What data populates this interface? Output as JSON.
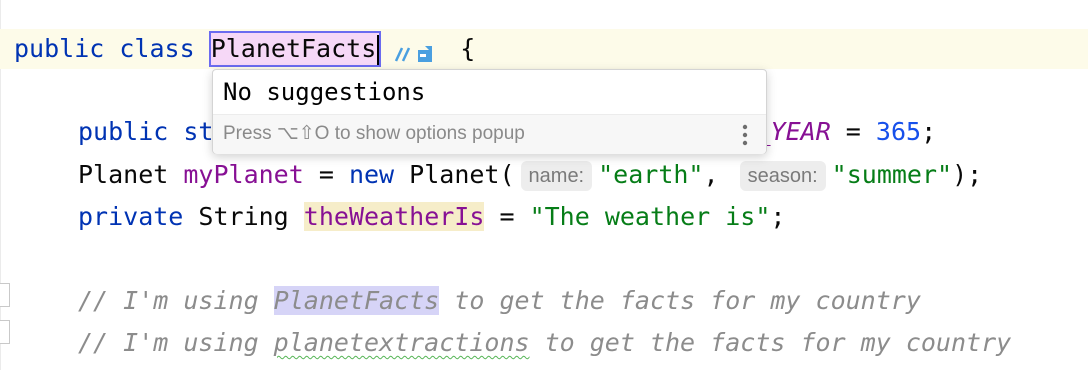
{
  "editor": {
    "line1": {
      "kw_public": "public",
      "kw_class": "class",
      "class_name": "PlanetFacts",
      "brace": "{"
    },
    "line2": {
      "kw_public": "public",
      "kw_partial": "st",
      "const_suffix": "_YEAR",
      "equals": " = ",
      "number": "365",
      "semicolon": ";"
    },
    "line3": {
      "type": "Planet",
      "var_name": "myPlanet",
      "equals": " = ",
      "kw_new": "new",
      "ctor_open": "Planet(",
      "hint_name": "name:",
      "arg1": "\"earth\"",
      "comma": ",",
      "hint_season": "season:",
      "arg2": "\"summer\"",
      "close": ");"
    },
    "line4": {
      "kw_private": "private",
      "type": "String",
      "field_name": "theWeatherIs",
      "equals": " = ",
      "string": "\"The weather is\"",
      "semicolon": ";"
    },
    "comment1": {
      "prefix": "// I'm using ",
      "highlight": "PlanetFacts",
      "suffix": " to get the facts for my country"
    },
    "comment2": {
      "prefix": "// I'm using ",
      "misspelled": "planetextractions",
      "suffix": " to get the facts for my country"
    }
  },
  "popup": {
    "message": "No suggestions",
    "hint": "Press ⌥⇧O to show options popup",
    "more_icon": "vertical-ellipsis-icon"
  },
  "icons": {
    "rename_tools": "rename-tools-icon",
    "fold": "fold-marker-icon"
  },
  "colors": {
    "keyword": "#0033b3",
    "field": "#871094",
    "string": "#067d17",
    "number": "#1750eb",
    "comment": "#8c8c8c",
    "rename_box": "#6b6bf0",
    "rename_fill": "#f6d8f7",
    "caret_row": "#fdfbe9"
  }
}
